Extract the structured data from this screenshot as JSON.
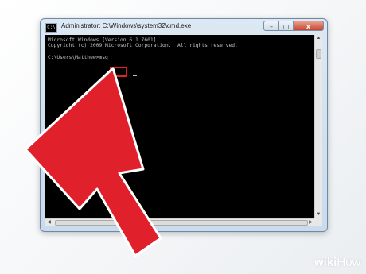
{
  "window": {
    "title": "Administrator: C:\\Windows\\system32\\cmd.exe",
    "icon": "cmd-icon",
    "controls": {
      "minimize": "–",
      "maximize": "□",
      "close": "x"
    }
  },
  "console": {
    "line1": "Microsoft Windows [Version 6.1.7601]",
    "line2": "Copyright (c) 2009 Microsoft Corporation.  All rights reserved.",
    "line3": "",
    "prompt": "C:\\Users\\Matthew>",
    "command": "msg",
    "text_color": "#c0c0c0",
    "background": "#000000"
  },
  "annotation": {
    "highlight_color": "#e0212c",
    "arrow_color": "#e0212c",
    "arrow_icon": "pointer-arrow-icon"
  },
  "watermark": {
    "brand_bold": "wiki",
    "brand_light": "How"
  }
}
